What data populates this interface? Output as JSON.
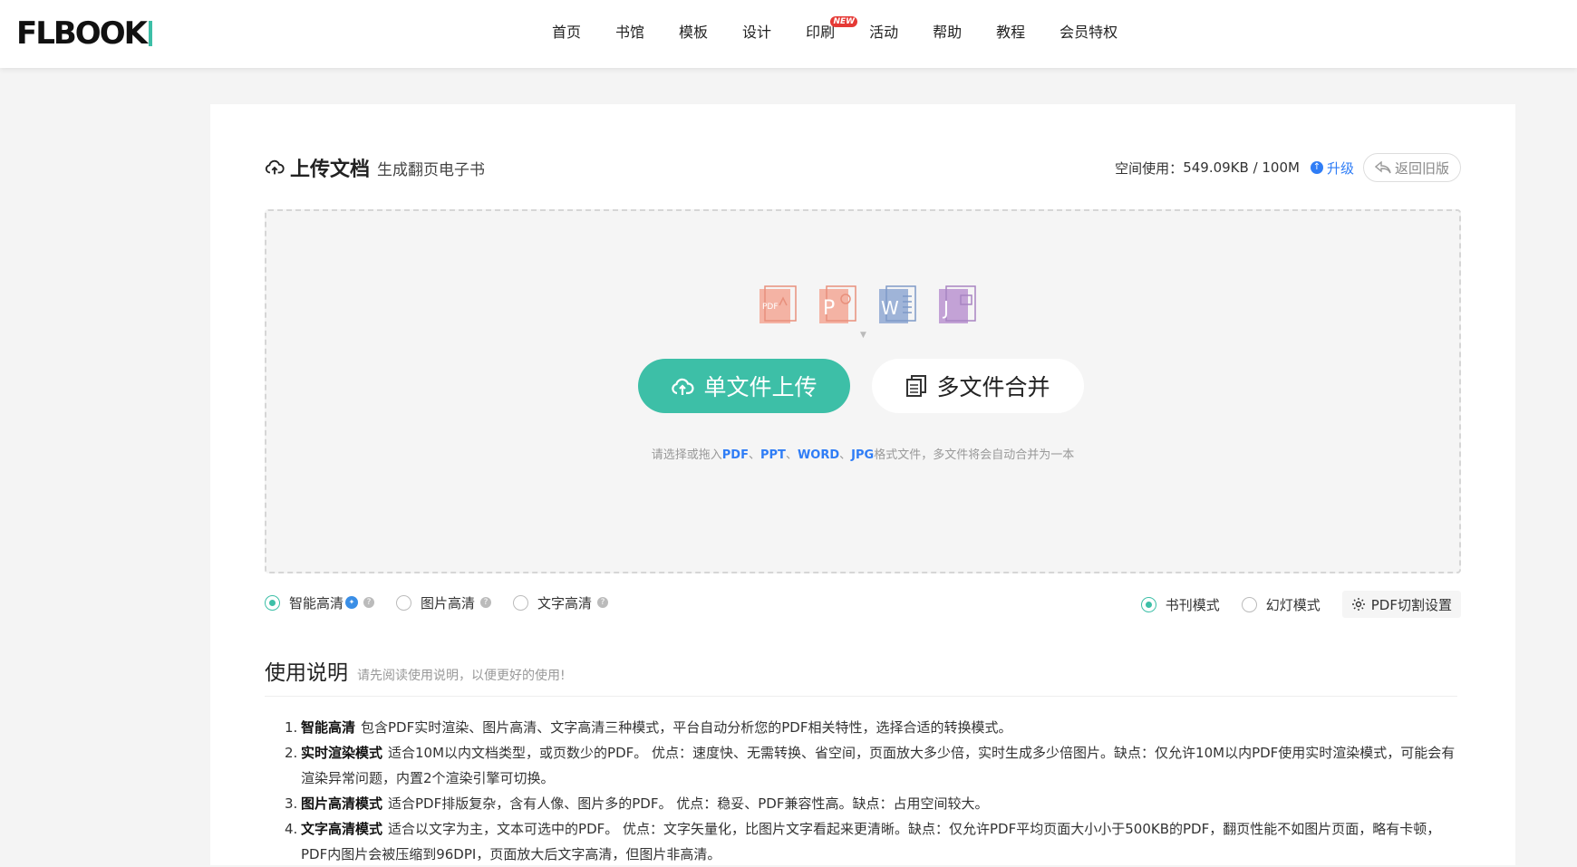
{
  "header": {
    "logo": "FLBOOK",
    "nav": [
      {
        "label": "首页"
      },
      {
        "label": "书馆"
      },
      {
        "label": "模板"
      },
      {
        "label": "设计"
      },
      {
        "label": "印刷",
        "badge": "NEW"
      },
      {
        "label": "活动"
      },
      {
        "label": "帮助"
      },
      {
        "label": "教程"
      },
      {
        "label": "会员特权"
      }
    ]
  },
  "upload": {
    "title": "上传文档",
    "subtitle": "生成翻页电子书",
    "space_label": "空间使用：",
    "space_value": "549.09KB / 100M",
    "upgrade_label": "升级",
    "return_label": "返回旧版",
    "file_icons": [
      "pdf-file-icon",
      "ppt-file-icon",
      "word-file-icon",
      "jpg-file-icon"
    ],
    "single_upload_label": "单文件上传",
    "multi_merge_label": "多文件合并",
    "hint_prefix": "请选择或拖入",
    "hint_formats": [
      "PDF",
      "PPT",
      "WORD",
      "JPG"
    ],
    "hint_suffix": "格式文件，多文件将会自动合并为一本",
    "quality_options": [
      {
        "label": "智能高清",
        "checked": true,
        "vip": true
      },
      {
        "label": "图片高清",
        "checked": false
      },
      {
        "label": "文字高清",
        "checked": false
      }
    ],
    "mode_options": [
      {
        "label": "书刊模式",
        "checked": true
      },
      {
        "label": "幻灯模式",
        "checked": false
      }
    ],
    "pdf_cut_label": "PDF切割设置"
  },
  "instructions": {
    "title": "使用说明",
    "subtitle": "请先阅读使用说明，以便更好的使用!",
    "items": [
      {
        "num": "1.",
        "term": "智能高清",
        "desc": "包含PDF实时渲染、图片高清、文字高清三种模式，平台自动分析您的PDF相关特性，选择合适的转换模式。"
      },
      {
        "num": "2.",
        "term": "实时渲染模式",
        "desc": "适合10M以内文档类型，或页数少的PDF。 优点：速度快、无需转换、省空间，页面放大多少倍，实时生成多少倍图片。缺点：仅允许10M以内PDF使用实时渲染模式，可能会有渲染异常问题，内置2个渲染引擎可切换。"
      },
      {
        "num": "3.",
        "term": "图片高清模式",
        "desc": "适合PDF排版复杂，含有人像、图片多的PDF。 优点：稳妥、PDF兼容性高。缺点：占用空间较大。"
      },
      {
        "num": "4.",
        "term": "文字高清模式",
        "desc": "适合以文字为主，文本可选中的PDF。 优点：文字矢量化，比图片文字看起来更清晰。缺点：仅允许PDF平均页面大小小于500KB的PDF，翻页性能不如图片页面，略有卡顿，PDF内图片会被压缩到96DPI，页面放大后文字高清，但图片非高清。"
      }
    ]
  },
  "colors": {
    "accent": "#3dbfa7",
    "link": "#2f7df6",
    "badge": "#e53935"
  }
}
